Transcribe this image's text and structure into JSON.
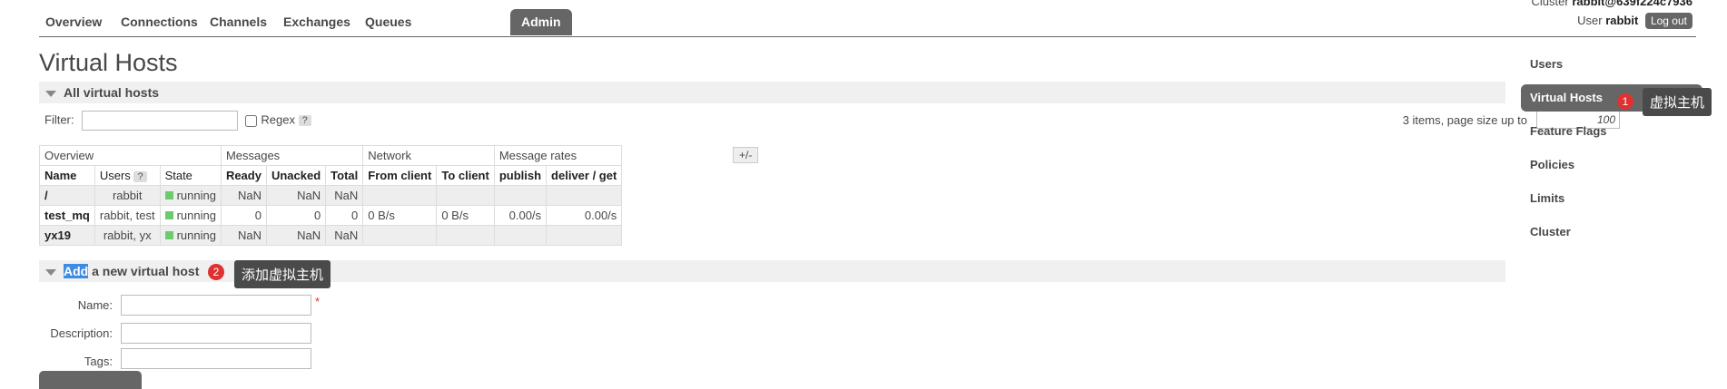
{
  "nav": {
    "tabs": [
      "Overview",
      "Connections",
      "Channels",
      "Exchanges",
      "Queues",
      "Admin"
    ],
    "active": "Admin",
    "cluster_label": "Cluster",
    "cluster_name": "rabbit@639f224c7936",
    "user_label": "User",
    "user_name": "rabbit",
    "logout_label": "Log out"
  },
  "page_title": "Virtual Hosts",
  "all_section": {
    "title": "All virtual hosts",
    "filter_label": "Filter:",
    "filter_value": "",
    "regex_label": "Regex",
    "help": "?",
    "paging_text": "3 items, page size up to",
    "page_size": "100",
    "plus_minus": "+/-"
  },
  "table": {
    "groups": [
      "Overview",
      "Messages",
      "Network",
      "Message rates"
    ],
    "columns": [
      "Name",
      "Users",
      "State",
      "Ready",
      "Unacked",
      "Total",
      "From client",
      "To client",
      "publish",
      "deliver / get"
    ],
    "users_help": "?",
    "rows": [
      {
        "name": "/",
        "users": "rabbit",
        "state": "running",
        "ready": "NaN",
        "unacked": "NaN",
        "total": "NaN",
        "from_client": "",
        "to_client": "",
        "publish": "",
        "deliver": ""
      },
      {
        "name": "test_mq",
        "users": "rabbit, test",
        "state": "running",
        "ready": "0",
        "unacked": "0",
        "total": "0",
        "from_client": "0 B/s",
        "to_client": "0 B/s",
        "publish": "0.00/s",
        "deliver": "0.00/s"
      },
      {
        "name": "yx19",
        "users": "rabbit, yx",
        "state": "running",
        "ready": "NaN",
        "unacked": "NaN",
        "total": "NaN",
        "from_client": "",
        "to_client": "",
        "publish": "",
        "deliver": ""
      }
    ]
  },
  "add_section": {
    "title_highlight": "Add",
    "title_rest": " a new virtual host",
    "name_label": "Name:",
    "required_mark": "*",
    "description_label": "Description:",
    "tags_label": "Tags:"
  },
  "annotations": {
    "badge1": "1",
    "tip1": "虚拟主机",
    "badge2": "2",
    "tip2": "添加虚拟主机"
  },
  "sidebar": {
    "items": [
      "Users",
      "Virtual Hosts",
      "Feature Flags",
      "Policies",
      "Limits",
      "Cluster"
    ],
    "active": "Virtual Hosts"
  },
  "colors": {
    "tab_active": "#666666",
    "running": "#6dca6d",
    "badge": "#e03131",
    "highlight": "#3c8be4"
  }
}
